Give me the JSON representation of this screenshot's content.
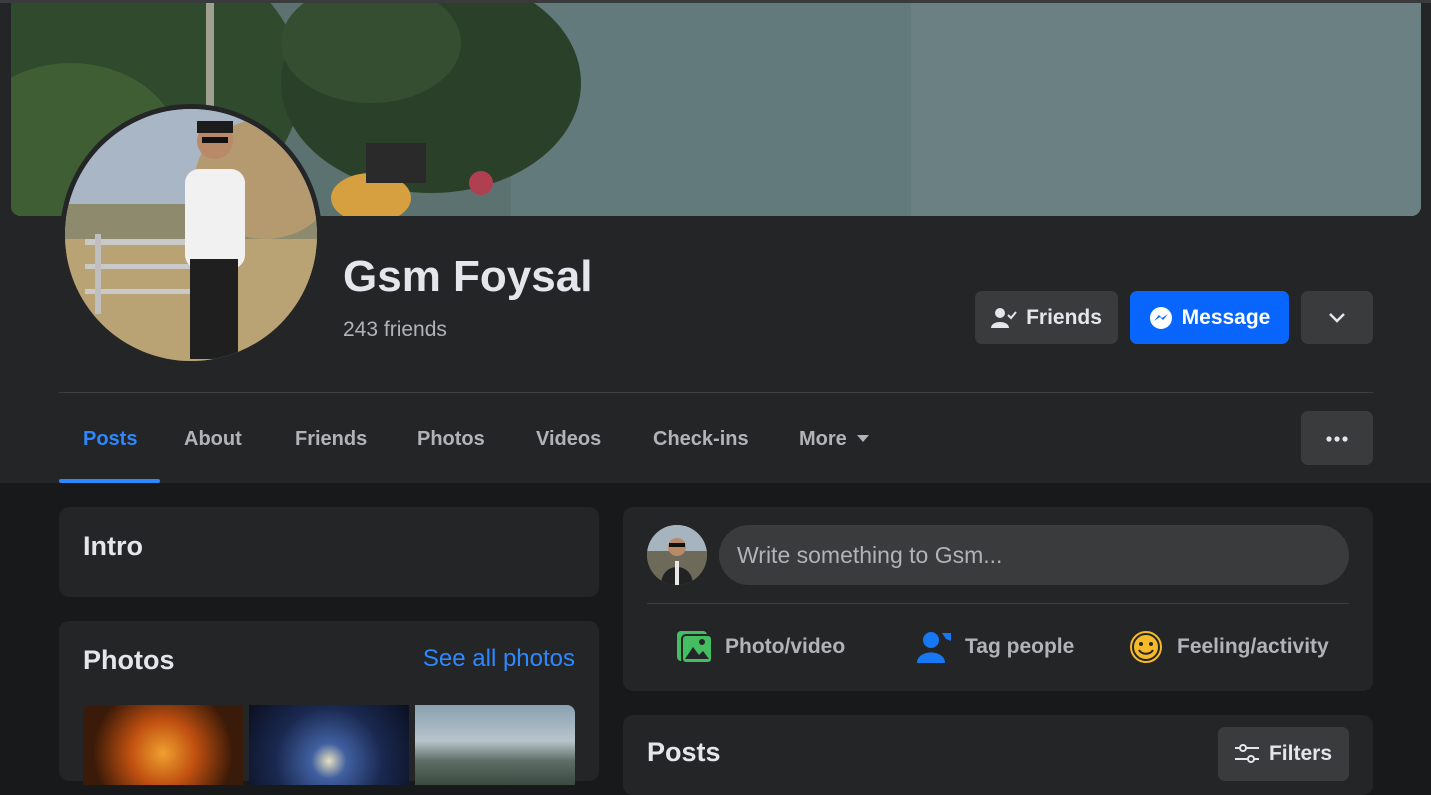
{
  "profile": {
    "name": "Gsm Foysal",
    "friend_count": "243 friends"
  },
  "actions": {
    "friends_label": "Friends",
    "message_label": "Message"
  },
  "tabs": [
    {
      "label": "Posts",
      "active": true
    },
    {
      "label": "About"
    },
    {
      "label": "Friends"
    },
    {
      "label": "Photos"
    },
    {
      "label": "Videos"
    },
    {
      "label": "Check-ins"
    },
    {
      "label": "More"
    }
  ],
  "intro": {
    "title": "Intro"
  },
  "photos": {
    "title": "Photos",
    "see_all": "See all photos"
  },
  "composer": {
    "placeholder": "Write something to Gsm...",
    "actions": [
      {
        "label": "Photo/video",
        "icon": "photo-video-icon"
      },
      {
        "label": "Tag people",
        "icon": "tag-people-icon"
      },
      {
        "label": "Feeling/activity",
        "icon": "feeling-icon"
      }
    ]
  },
  "posts": {
    "title": "Posts",
    "filters_label": "Filters"
  },
  "colors": {
    "background": "#18191a",
    "surface": "#242526",
    "button": "#3a3b3c",
    "accent": "#2d88ff",
    "primary_button": "#0866ff"
  }
}
